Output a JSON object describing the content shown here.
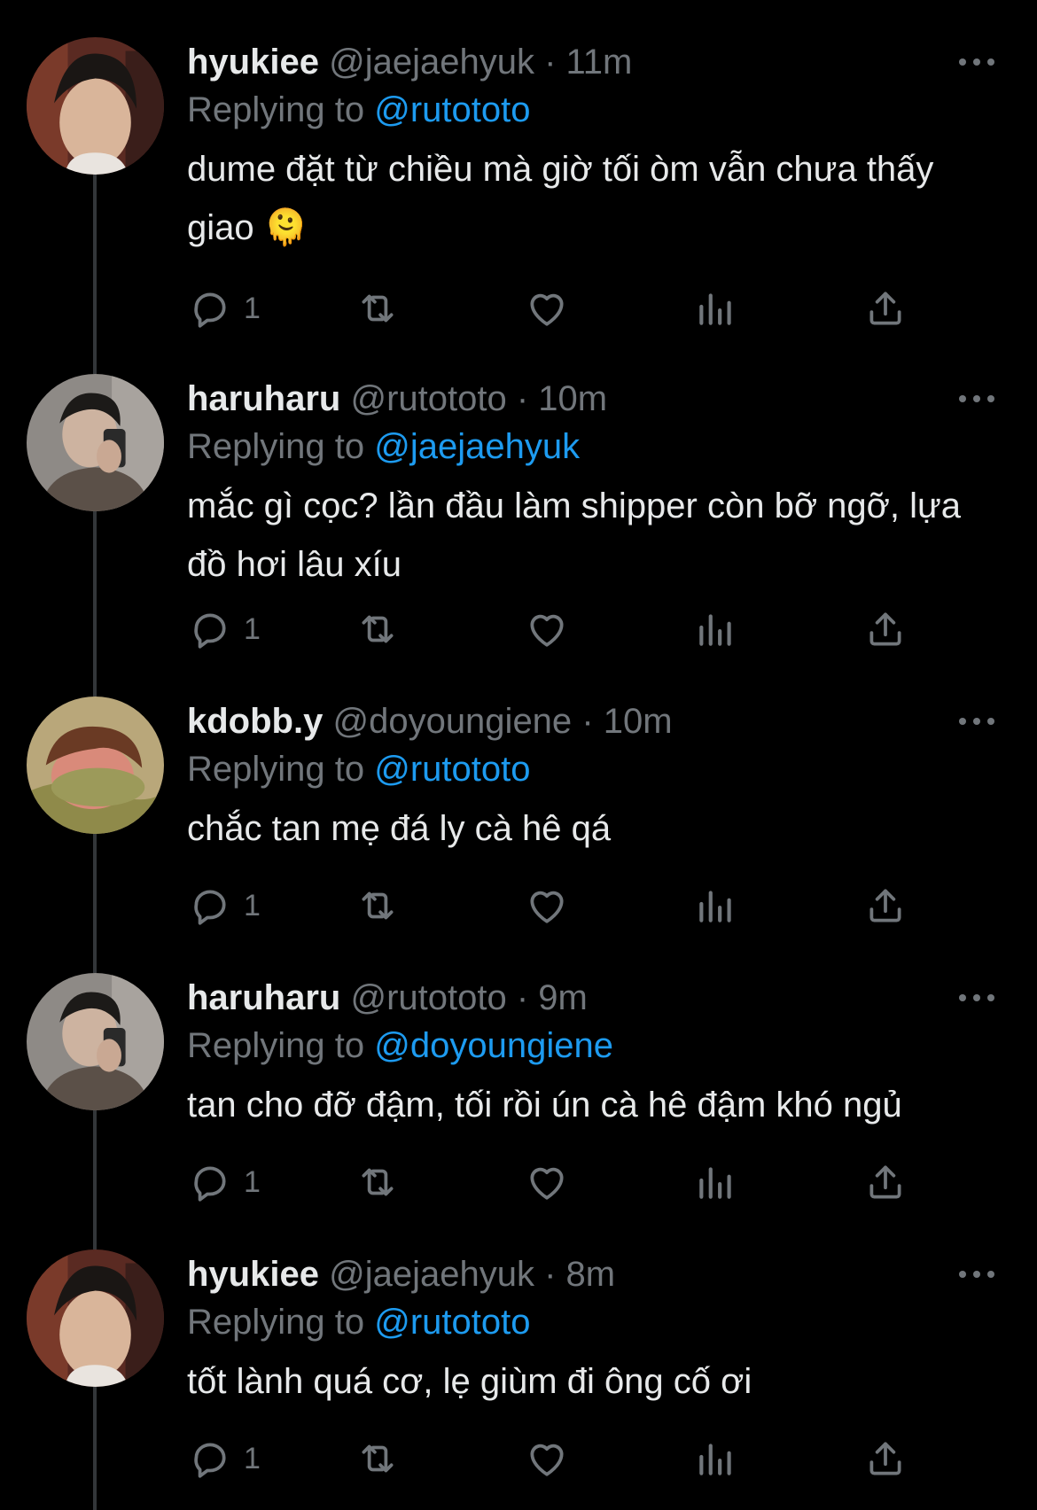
{
  "colors": {
    "background": "#000000",
    "text": "#e7e9ea",
    "muted": "#71767b",
    "mention": "#1d9bf0",
    "thread_line": "#333639"
  },
  "tweets": [
    {
      "display_name": "hyukiee",
      "handle": "@jaejaehyuk",
      "time": "11m",
      "replying_label": "Replying to",
      "replying_to": "@rutototo",
      "text": "dume đặt từ chiều mà giờ tối òm vẫn chưa thấy giao 🫠",
      "reply_count": "1",
      "avatar": "avatar-hyukiee"
    },
    {
      "display_name": "haruharu",
      "handle": "@rutototo",
      "time": "10m",
      "replying_label": "Replying to",
      "replying_to": "@jaejaehyuk",
      "text": "mắc gì cọc? lần đầu làm shipper còn bỡ ngỡ, lựa đồ hơi lâu xíu",
      "reply_count": "1",
      "avatar": "avatar-haruharu"
    },
    {
      "display_name": "kdobb.y",
      "handle": "@doyoungiene",
      "time": "10m",
      "replying_label": "Replying to",
      "replying_to": "@rutototo",
      "text": "chắc tan mẹ đá ly cà hê qá",
      "reply_count": "1",
      "avatar": "avatar-kdobby"
    },
    {
      "display_name": "haruharu",
      "handle": "@rutototo",
      "time": "9m",
      "replying_label": "Replying to",
      "replying_to": "@doyoungiene",
      "text": "tan cho đỡ đậm, tối rồi ún cà hê đậm khó ngủ",
      "reply_count": "1",
      "avatar": "avatar-haruharu"
    },
    {
      "display_name": "hyukiee",
      "handle": "@jaejaehyuk",
      "time": "8m",
      "replying_label": "Replying to",
      "replying_to": "@rutototo",
      "text": "tốt lành quá cơ, lẹ giùm đi ông cố ơi",
      "reply_count": "1",
      "avatar": "avatar-hyukiee"
    }
  ]
}
